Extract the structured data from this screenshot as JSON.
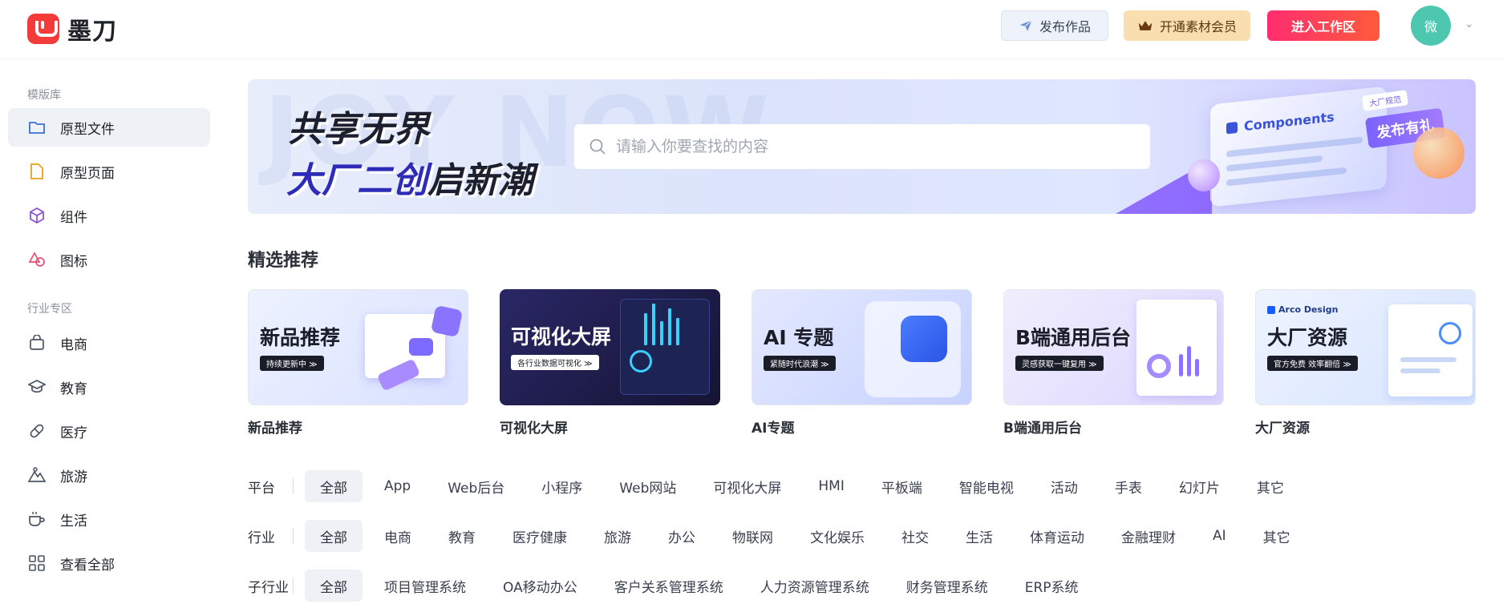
{
  "header": {
    "logo_text": "墨刀",
    "publish_label": "发布作品",
    "vip_label": "开通素材会员",
    "workspace_label": "进入工作区",
    "avatar_text": "微"
  },
  "sidebar": {
    "section1": "模版库",
    "items1": [
      {
        "label": "原型文件",
        "icon": "folder-icon"
      },
      {
        "label": "原型页面",
        "icon": "file-icon"
      },
      {
        "label": "组件",
        "icon": "cube-icon"
      },
      {
        "label": "图标",
        "icon": "shapes-icon"
      }
    ],
    "section2": "行业专区",
    "items2": [
      {
        "label": "电商",
        "icon": "shopping-bag-icon"
      },
      {
        "label": "教育",
        "icon": "graduation-cap-icon"
      },
      {
        "label": "医疗",
        "icon": "pill-icon"
      },
      {
        "label": "旅游",
        "icon": "mountain-icon"
      },
      {
        "label": "生活",
        "icon": "cup-icon"
      },
      {
        "label": "查看全部",
        "icon": "grid-icon"
      }
    ]
  },
  "banner": {
    "line1": "共享无界",
    "line2a": "大厂二创",
    "line2b": "启新潮",
    "search_placeholder": "请输入你要查找的内容",
    "components_text": "Components",
    "tag_small": "大厂规范",
    "tag_big": "发布有礼"
  },
  "featured": {
    "title": "精选推荐",
    "cards": [
      {
        "heading": "新品推荐",
        "pill": "持续更新中 ≫",
        "label": "新品推荐"
      },
      {
        "heading": "可视化大屏",
        "pill": "各行业数据可视化 ≫",
        "label": "可视化大屏"
      },
      {
        "heading": "AI 专题",
        "pill": "紧随时代浪潮 ≫",
        "label": "AI专题"
      },
      {
        "heading": "B端通用后台",
        "pill": "灵感获取一键复用 ≫",
        "label": "B端通用后台"
      },
      {
        "heading": "大厂资源",
        "pill": "官方免费 效率翻倍 ≫",
        "label": "大厂资源",
        "brand": "Arco Design"
      }
    ]
  },
  "filters": {
    "platform": {
      "label": "平台",
      "options": [
        "全部",
        "App",
        "Web后台",
        "小程序",
        "Web网站",
        "可视化大屏",
        "HMI",
        "平板端",
        "智能电视",
        "活动",
        "手表",
        "幻灯片",
        "其它"
      ]
    },
    "industry": {
      "label": "行业",
      "options": [
        "全部",
        "电商",
        "教育",
        "医疗健康",
        "旅游",
        "办公",
        "物联网",
        "文化娱乐",
        "社交",
        "生活",
        "体育运动",
        "金融理财",
        "AI",
        "其它"
      ]
    },
    "sub_industry": {
      "label": "子行业",
      "options": [
        "全部",
        "项目管理系统",
        "OA移动办公",
        "客户关系管理系统",
        "人力资源管理系统",
        "财务管理系统",
        "ERP系统"
      ]
    }
  }
}
